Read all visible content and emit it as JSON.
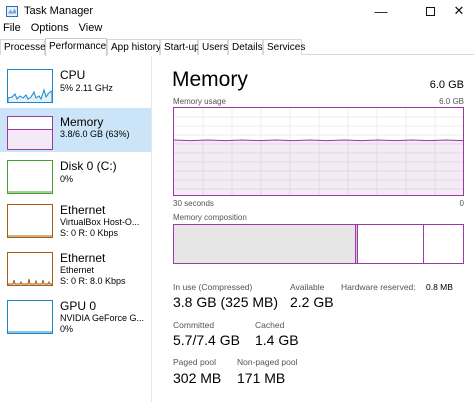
{
  "window": {
    "title": "Task Manager",
    "minimize_glyph": "—",
    "close_glyph": "✕"
  },
  "menu": [
    "File",
    "Options",
    "View"
  ],
  "tabs": [
    "Processes",
    "Performance",
    "App history",
    "Start-up",
    "Users",
    "Details",
    "Services"
  ],
  "active_tab": "Performance",
  "colors": {
    "cpu": "#1b86c9",
    "memory": "#9a3aa3",
    "disk": "#4aa02c",
    "ethernet": "#a75d12",
    "gpu": "#1b86c9",
    "selected": "#cce4f7"
  },
  "sidebar": [
    {
      "name": "CPU",
      "line1": "5% 2.11 GHz",
      "line2": "",
      "icon": "cpu-graph-icon"
    },
    {
      "name": "Memory",
      "line1": "3.8/6.0 GB (63%)",
      "line2": "",
      "icon": "memory-graph-icon",
      "usage": 0.63
    },
    {
      "name": "Disk 0 (C:)",
      "line1": "0%",
      "line2": "",
      "icon": "disk-graph-icon"
    },
    {
      "name": "Ethernet",
      "line1": "VirtualBox Host-O...",
      "line2": "S: 0 R: 0 Kbps",
      "icon": "ethernet-graph-icon"
    },
    {
      "name": "Ethernet",
      "line1": "Ethernet",
      "line2": "S: 0 R: 8.0 Kbps",
      "icon": "ethernet-graph-icon"
    },
    {
      "name": "GPU 0",
      "line1": "NVIDIA GeForce G...",
      "line2": "0%",
      "icon": "gpu-graph-icon"
    }
  ],
  "main": {
    "title": "Memory",
    "total": "6.0 GB",
    "usage_label": "Memory usage",
    "usage_max": "6.0 GB",
    "usage_fraction": 0.63,
    "time_left": "30 seconds",
    "time_right": "0",
    "composition_label": "Memory composition",
    "composition": {
      "in_use": 0.63,
      "modified": 0.005,
      "standby": 0.23,
      "free": 0.115
    },
    "stats": {
      "in_use_label": "In use (Compressed)",
      "in_use_value": "3.8 GB (325 MB)",
      "available_label": "Available",
      "available_value": "2.2 GB",
      "hw_reserved_label": "Hardware reserved:",
      "hw_reserved_value": "0.8 MB",
      "committed_label": "Committed",
      "committed_value": "5.7/7.4 GB",
      "cached_label": "Cached",
      "cached_value": "1.4 GB",
      "paged_label": "Paged pool",
      "paged_value": "302 MB",
      "nonpaged_label": "Non-paged pool",
      "nonpaged_value": "171 MB"
    }
  }
}
